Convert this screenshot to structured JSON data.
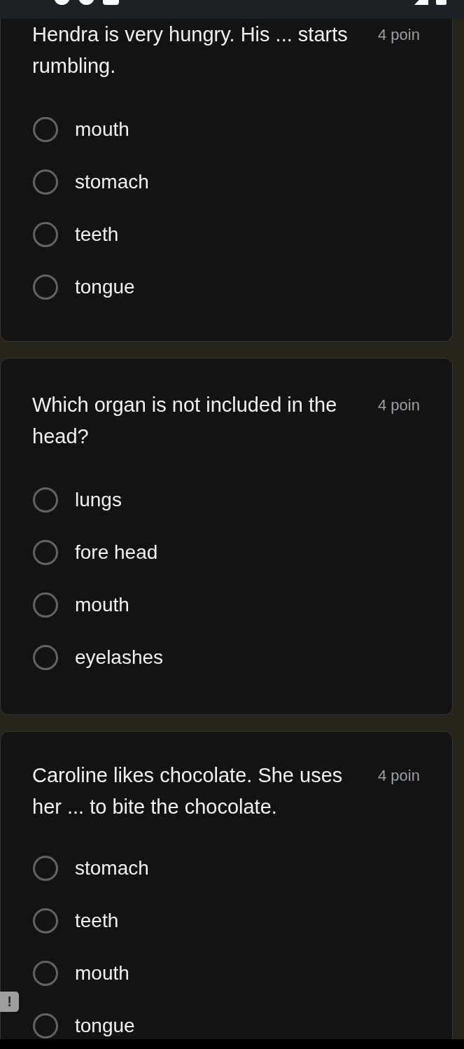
{
  "questions": [
    {
      "text": "Hendra is very hungry. His ... starts rumbling.",
      "points": "4 poin",
      "options": [
        {
          "label": "mouth",
          "selected": false
        },
        {
          "label": "stomach",
          "selected": false
        },
        {
          "label": "teeth",
          "selected": false
        },
        {
          "label": "tongue",
          "selected": false
        }
      ]
    },
    {
      "text": "Which organ is not included in the head?",
      "points": "4 poin",
      "options": [
        {
          "label": "lungs",
          "selected": false
        },
        {
          "label": "fore head",
          "selected": false
        },
        {
          "label": "mouth",
          "selected": false
        },
        {
          "label": "eyelashes",
          "selected": false
        }
      ]
    },
    {
      "text": "Caroline likes chocolate. She uses her ... to bite the chocolate.",
      "points": "4 poin",
      "options": [
        {
          "label": "stomach",
          "selected": false
        },
        {
          "label": "teeth",
          "selected": false
        },
        {
          "label": "mouth",
          "selected": false
        },
        {
          "label": "tongue",
          "selected": false
        }
      ]
    }
  ],
  "feedback_button": {
    "label": "!"
  }
}
